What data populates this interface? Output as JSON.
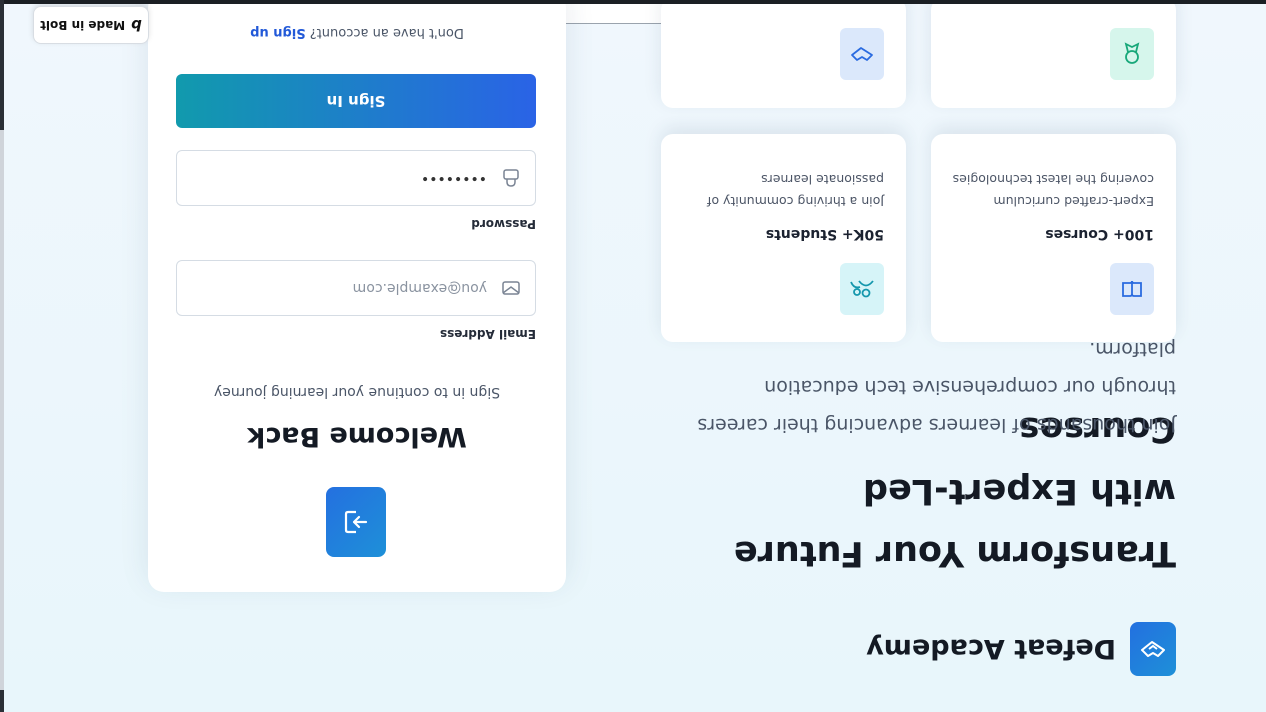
{
  "brand": {
    "name": "Defeat Academy",
    "logo_icon": "handshake-icon"
  },
  "hero": {
    "title": "Transform Your Future with Expert-Led Courses",
    "subtitle": "Join thousands of learners advancing their careers through our comprehensive tech education platform."
  },
  "stats": [
    {
      "title": "100+ Courses",
      "desc": "Expert-crafted curriculum covering the latest technologies",
      "icon": "book-icon"
    },
    {
      "title": "50K+ Students",
      "desc": "Join a thriving community of passionate learners",
      "icon": "users-icon"
    },
    {
      "title": "",
      "desc": "",
      "icon": "award-icon"
    },
    {
      "title": "",
      "desc": "",
      "icon": "handshake-icon"
    }
  ],
  "login": {
    "icon": "sign-in-icon",
    "title": "Welcome Back",
    "subtitle": "Sign in to continue your learning journey",
    "email_label": "Email Address",
    "email_placeholder": "you@example.com",
    "password_label": "Password",
    "password_value": "••••••••",
    "signin_button": "Sign In",
    "signup_prompt": "Don't have an account?",
    "signup_link": "Sign up"
  },
  "badge": {
    "text": "Made in Bolt"
  },
  "colors": {
    "accent": "#2470e0",
    "teal": "#119aad",
    "link": "#2259d8"
  }
}
